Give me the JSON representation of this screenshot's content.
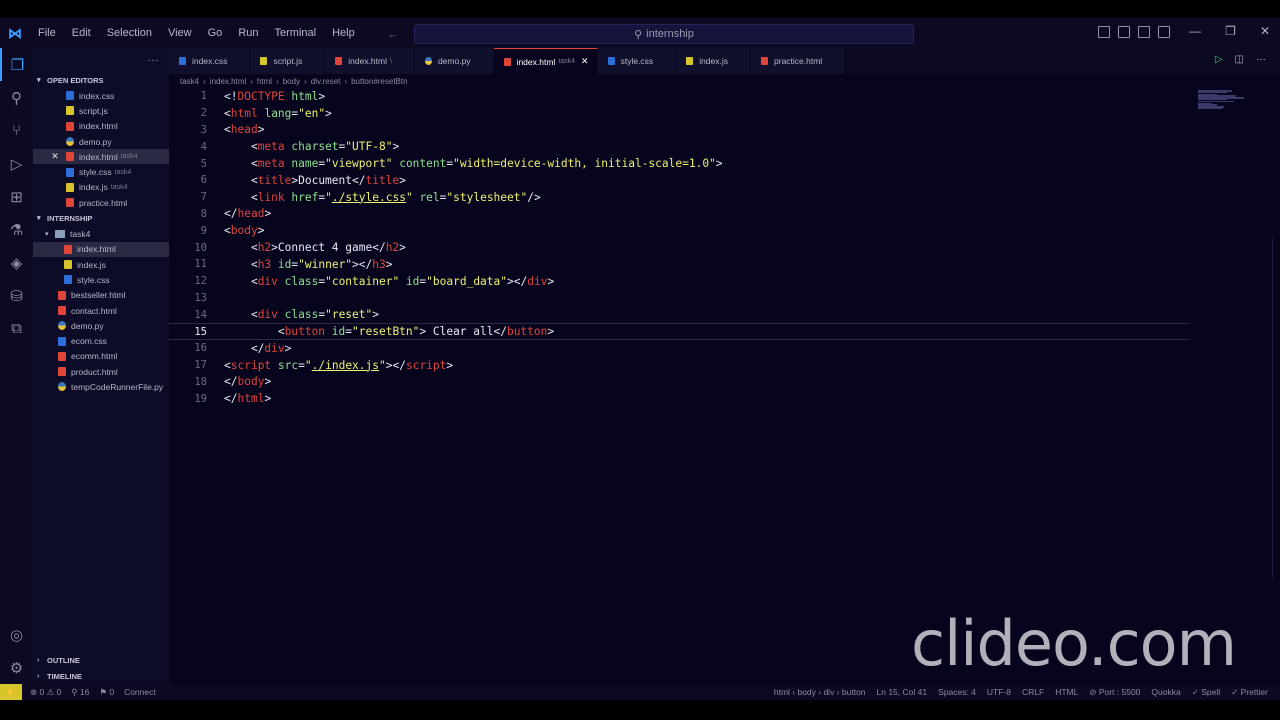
{
  "titlebar": {
    "menu": [
      "File",
      "Edit",
      "Selection",
      "View",
      "Go",
      "Run",
      "Terminal",
      "Help"
    ],
    "search_text": "internship",
    "window_controls": [
      "—",
      "❐",
      "✕"
    ]
  },
  "sidebar": {
    "open_editors_title": "OPEN EDITORS",
    "open_editors": [
      {
        "name": "index.css",
        "type": "css",
        "tag": ""
      },
      {
        "name": "script.js",
        "type": "js",
        "tag": ""
      },
      {
        "name": "index.html",
        "type": "html",
        "tag": ""
      },
      {
        "name": "demo.py",
        "type": "py",
        "tag": ""
      },
      {
        "name": "index.html",
        "type": "html",
        "tag": "task4"
      },
      {
        "name": "style.css",
        "type": "css",
        "tag": "task4"
      },
      {
        "name": "index.js",
        "type": "js",
        "tag": "task4"
      },
      {
        "name": "practice.html",
        "type": "html",
        "tag": ""
      }
    ],
    "workspace_title": "INTERNSHIP",
    "folder": "task4",
    "folder_files": [
      "index.html",
      "index.js",
      "style.css"
    ],
    "root_files": [
      {
        "name": "bestseller.html",
        "type": "html"
      },
      {
        "name": "contact.html",
        "type": "html"
      },
      {
        "name": "demo.py",
        "type": "py"
      },
      {
        "name": "ecom.css",
        "type": "css"
      },
      {
        "name": "ecomm.html",
        "type": "html"
      },
      {
        "name": "product.html",
        "type": "html"
      },
      {
        "name": "tempCodeRunnerFile.py",
        "type": "py"
      }
    ],
    "outline_title": "OUTLINE",
    "timeline_title": "TIMELINE"
  },
  "tabs": [
    {
      "label": "index.css",
      "type": "css",
      "sub": ""
    },
    {
      "label": "script.js",
      "type": "js",
      "sub": ""
    },
    {
      "label": "index.html",
      "type": "html",
      "sub": "\\"
    },
    {
      "label": "demo.py",
      "type": "py",
      "sub": ""
    },
    {
      "label": "index.html",
      "type": "html",
      "sub": "task4",
      "active": true
    },
    {
      "label": "style.css",
      "type": "css",
      "sub": ""
    },
    {
      "label": "index.js",
      "type": "js",
      "sub": ""
    },
    {
      "label": "practice.html",
      "type": "html",
      "sub": ""
    }
  ],
  "breadcrumb": [
    "task4",
    "index.html",
    "html",
    "body",
    "div.reset",
    "button#resetBtn"
  ],
  "editor": {
    "current_line": 15,
    "lines": [
      [
        [
          "t",
          "<!"
        ],
        [
          "g",
          "DOCTYPE"
        ],
        [
          "t",
          " "
        ],
        [
          "a",
          "html"
        ],
        [
          "t",
          ">"
        ]
      ],
      [
        [
          "t",
          "<"
        ],
        [
          "g",
          "html"
        ],
        [
          "t",
          " "
        ],
        [
          "a",
          "lang"
        ],
        [
          "t",
          "="
        ],
        [
          "s",
          "\"en\""
        ],
        [
          "t",
          ">"
        ]
      ],
      [
        [
          "t",
          "<"
        ],
        [
          "g",
          "head"
        ],
        [
          "t",
          ">"
        ]
      ],
      [
        [
          "t",
          "    <"
        ],
        [
          "g",
          "meta"
        ],
        [
          "t",
          " "
        ],
        [
          "a",
          "charset"
        ],
        [
          "t",
          "="
        ],
        [
          "s",
          "\"UTF-8\""
        ],
        [
          "t",
          ">"
        ]
      ],
      [
        [
          "t",
          "    <"
        ],
        [
          "g",
          "meta"
        ],
        [
          "t",
          " "
        ],
        [
          "a",
          "name"
        ],
        [
          "t",
          "="
        ],
        [
          "s",
          "\"viewport\""
        ],
        [
          "t",
          " "
        ],
        [
          "a",
          "content"
        ],
        [
          "t",
          "="
        ],
        [
          "s",
          "\"width=device-width, initial-scale=1.0\""
        ],
        [
          "t",
          ">"
        ]
      ],
      [
        [
          "t",
          "    <"
        ],
        [
          "g",
          "title"
        ],
        [
          "t",
          ">Document</"
        ],
        [
          "g",
          "title"
        ],
        [
          "t",
          ">"
        ]
      ],
      [
        [
          "t",
          "    <"
        ],
        [
          "g",
          "link"
        ],
        [
          "t",
          " "
        ],
        [
          "a",
          "href"
        ],
        [
          "t",
          "="
        ],
        [
          "s",
          "\""
        ],
        [
          "l",
          "./style.css"
        ],
        [
          "s",
          "\""
        ],
        [
          "t",
          " "
        ],
        [
          "a",
          "rel"
        ],
        [
          "t",
          "="
        ],
        [
          "s",
          "\"stylesheet\""
        ],
        [
          "t",
          "/>"
        ]
      ],
      [
        [
          "t",
          "</"
        ],
        [
          "g",
          "head"
        ],
        [
          "t",
          ">"
        ]
      ],
      [
        [
          "t",
          "<"
        ],
        [
          "g",
          "body"
        ],
        [
          "t",
          ">"
        ]
      ],
      [
        [
          "t",
          "    <"
        ],
        [
          "g",
          "h2"
        ],
        [
          "t",
          ">Connect 4 game</"
        ],
        [
          "g",
          "h2"
        ],
        [
          "t",
          ">"
        ]
      ],
      [
        [
          "t",
          "    <"
        ],
        [
          "g",
          "h3"
        ],
        [
          "t",
          " "
        ],
        [
          "a",
          "id"
        ],
        [
          "t",
          "="
        ],
        [
          "s",
          "\"winner\""
        ],
        [
          "t",
          "></"
        ],
        [
          "g",
          "h3"
        ],
        [
          "t",
          ">"
        ]
      ],
      [
        [
          "t",
          "    <"
        ],
        [
          "g",
          "div"
        ],
        [
          "t",
          " "
        ],
        [
          "a",
          "class"
        ],
        [
          "t",
          "="
        ],
        [
          "s",
          "\"container\""
        ],
        [
          "t",
          " "
        ],
        [
          "a",
          "id"
        ],
        [
          "t",
          "="
        ],
        [
          "s",
          "\"board_data\""
        ],
        [
          "t",
          "></"
        ],
        [
          "g",
          "div"
        ],
        [
          "t",
          ">"
        ]
      ],
      [
        [
          "t",
          ""
        ]
      ],
      [
        [
          "t",
          "    <"
        ],
        [
          "g",
          "div"
        ],
        [
          "t",
          " "
        ],
        [
          "a",
          "class"
        ],
        [
          "t",
          "="
        ],
        [
          "s",
          "\"reset\""
        ],
        [
          "t",
          ">"
        ]
      ],
      [
        [
          "t",
          "        <"
        ],
        [
          "g",
          "button"
        ],
        [
          "t",
          " "
        ],
        [
          "a",
          "id"
        ],
        [
          "t",
          "="
        ],
        [
          "s",
          "\"resetBtn\""
        ],
        [
          "t",
          "> Clear all</"
        ],
        [
          "g",
          "button"
        ],
        [
          "t",
          ">"
        ]
      ],
      [
        [
          "t",
          "    </"
        ],
        [
          "g",
          "div"
        ],
        [
          "t",
          ">"
        ]
      ],
      [
        [
          "t",
          "<"
        ],
        [
          "g",
          "script"
        ],
        [
          "t",
          " "
        ],
        [
          "a",
          "src"
        ],
        [
          "t",
          "="
        ],
        [
          "s",
          "\""
        ],
        [
          "l",
          "./index.js"
        ],
        [
          "s",
          "\""
        ],
        [
          "t",
          "></"
        ],
        [
          "g",
          "script"
        ],
        [
          "t",
          ">"
        ]
      ],
      [
        [
          "t",
          "</"
        ],
        [
          "g",
          "body"
        ],
        [
          "t",
          ">"
        ]
      ],
      [
        [
          "t",
          "</"
        ],
        [
          "g",
          "html"
        ],
        [
          "t",
          ">"
        ]
      ]
    ]
  },
  "watermark": "clideo.com",
  "statusbar": {
    "left": [
      "⊗ 0 ⚠ 0",
      "⚲ 16",
      "⚑ 0",
      "Connect"
    ],
    "right": [
      "html › body › div › button",
      "Ln 15, Col 41",
      "Spaces: 4",
      "UTF-8",
      "CRLF",
      "HTML",
      "⊘ Port : 5500",
      "Quokka",
      "✓ Spell",
      "✓ Prettier"
    ]
  },
  "colors": {
    "tag": "#e0453a",
    "attr": "#8ee08e",
    "string": "#f0f070",
    "accent": "#3aa0ff"
  }
}
